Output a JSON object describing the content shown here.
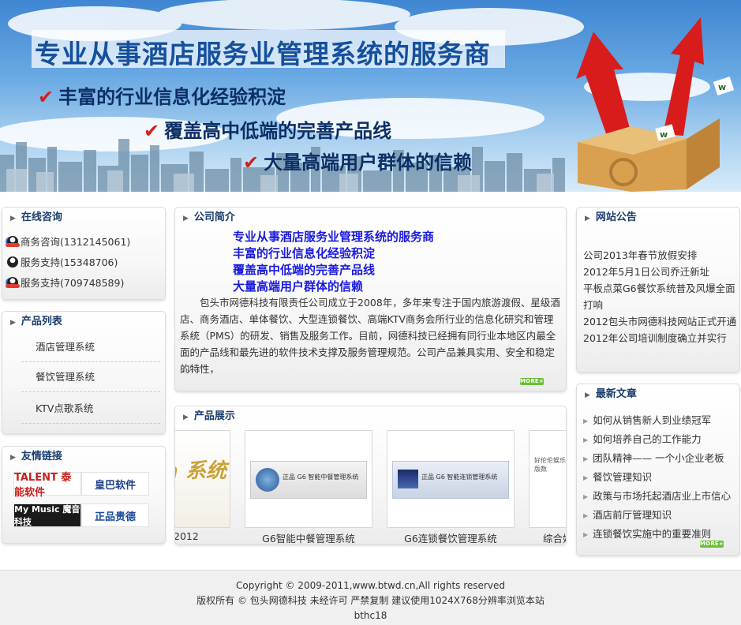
{
  "banner": {
    "title": "专业从事酒店服务业管理系统的服务商",
    "slogans": [
      "丰富的行业信息化经验积淀",
      "覆盖高中低端的完善产品线",
      "大量高端用户群体的信赖"
    ],
    "colors": {
      "sky": "#4a8fd8",
      "title": "#15509c",
      "check": "#d41e1e"
    }
  },
  "consult": {
    "heading": "在线咨询",
    "items": [
      {
        "label": "商务咨询(1312145061)",
        "icon": "qq-online-icon"
      },
      {
        "label": "服务支持(15348706)",
        "icon": "qq-offline-icon"
      },
      {
        "label": "服务支持(709748589)",
        "icon": "qq-online-icon"
      }
    ]
  },
  "products": {
    "heading": "产品列表",
    "items": [
      "酒店管理系统",
      "餐饮管理系统",
      "KTV点歌系统"
    ]
  },
  "links": {
    "heading": "友情链接",
    "logos": [
      {
        "text": "TALENT 泰能软件",
        "color": "#c8201f"
      },
      {
        "text": "皇巴软件",
        "color": "#1d3f8c"
      },
      {
        "text": "My Music 魔音科技",
        "color": "#ffffff"
      },
      {
        "text": "正品贵德",
        "color": "#1a4a9a"
      }
    ]
  },
  "intro": {
    "heading": "公司简介",
    "lines": [
      "专业从事酒店服务业管理系统的服务商",
      "丰富的行业信息化经验积淀",
      "覆盖高中低端的完善产品线",
      "大量高端用户群体的信赖"
    ],
    "text": "包头市网德科技有限责任公司成立于2008年，多年来专注于国内旅游渡假、星级酒店、商务酒店、单体餐饮、大型连锁餐饮、高端KTV商务会所行业的信息化研究和管理系统（PMS）的研发、销售及服务工作。目前，网德科技已经拥有同行业本地区内最全面的产品线和最先进的软件技术支撑及服务管理规范。公司产品兼具实用、安全和稳定的特性，",
    "ellipsis": "……",
    "more": "MORE+"
  },
  "showcase": {
    "heading": "产品展示",
    "cards": [
      {
        "caption": "2012",
        "image_text": "ta 系统"
      },
      {
        "caption": "G6智能中餐管理系统",
        "image_text": "正品 G6 智能中餐管理系统"
      },
      {
        "caption": "G6连锁餐饮管理系统",
        "image_text": "正品 G6 智能连锁管理系统"
      },
      {
        "caption": "综合娱",
        "image_text": "好伦伦娱乐服务 一单版数"
      }
    ]
  },
  "notice": {
    "heading": "网站公告",
    "items": [
      "公司2013年春节放假安排",
      "2012年5月1日公司乔迁新址",
      "平板点菜G6餐饮系统普及风爆全面",
      "打响",
      "2012包头市网德科技网站正式开通",
      "2012年公司培训制度确立并实行"
    ]
  },
  "articles": {
    "heading": "最新文章",
    "items": [
      "如何从销售新人到业绩冠军",
      "如何培养自己的工作能力",
      "团队精神—— 一个小企业老板",
      "餐饮管理知识",
      "政策与市场托起酒店业上市信心",
      "酒店前厅管理知识",
      "连锁餐饮实施中的重要准则"
    ],
    "more": "MORE+"
  },
  "footer": {
    "copyright": "Copyright © 2009-2011,www.btwd.cn,All rights reserved",
    "rights": "版权所有 © 包头网德科技 未经许可 严禁复制 建议使用1024X768分辨率浏览本站",
    "code": "bthc18"
  }
}
